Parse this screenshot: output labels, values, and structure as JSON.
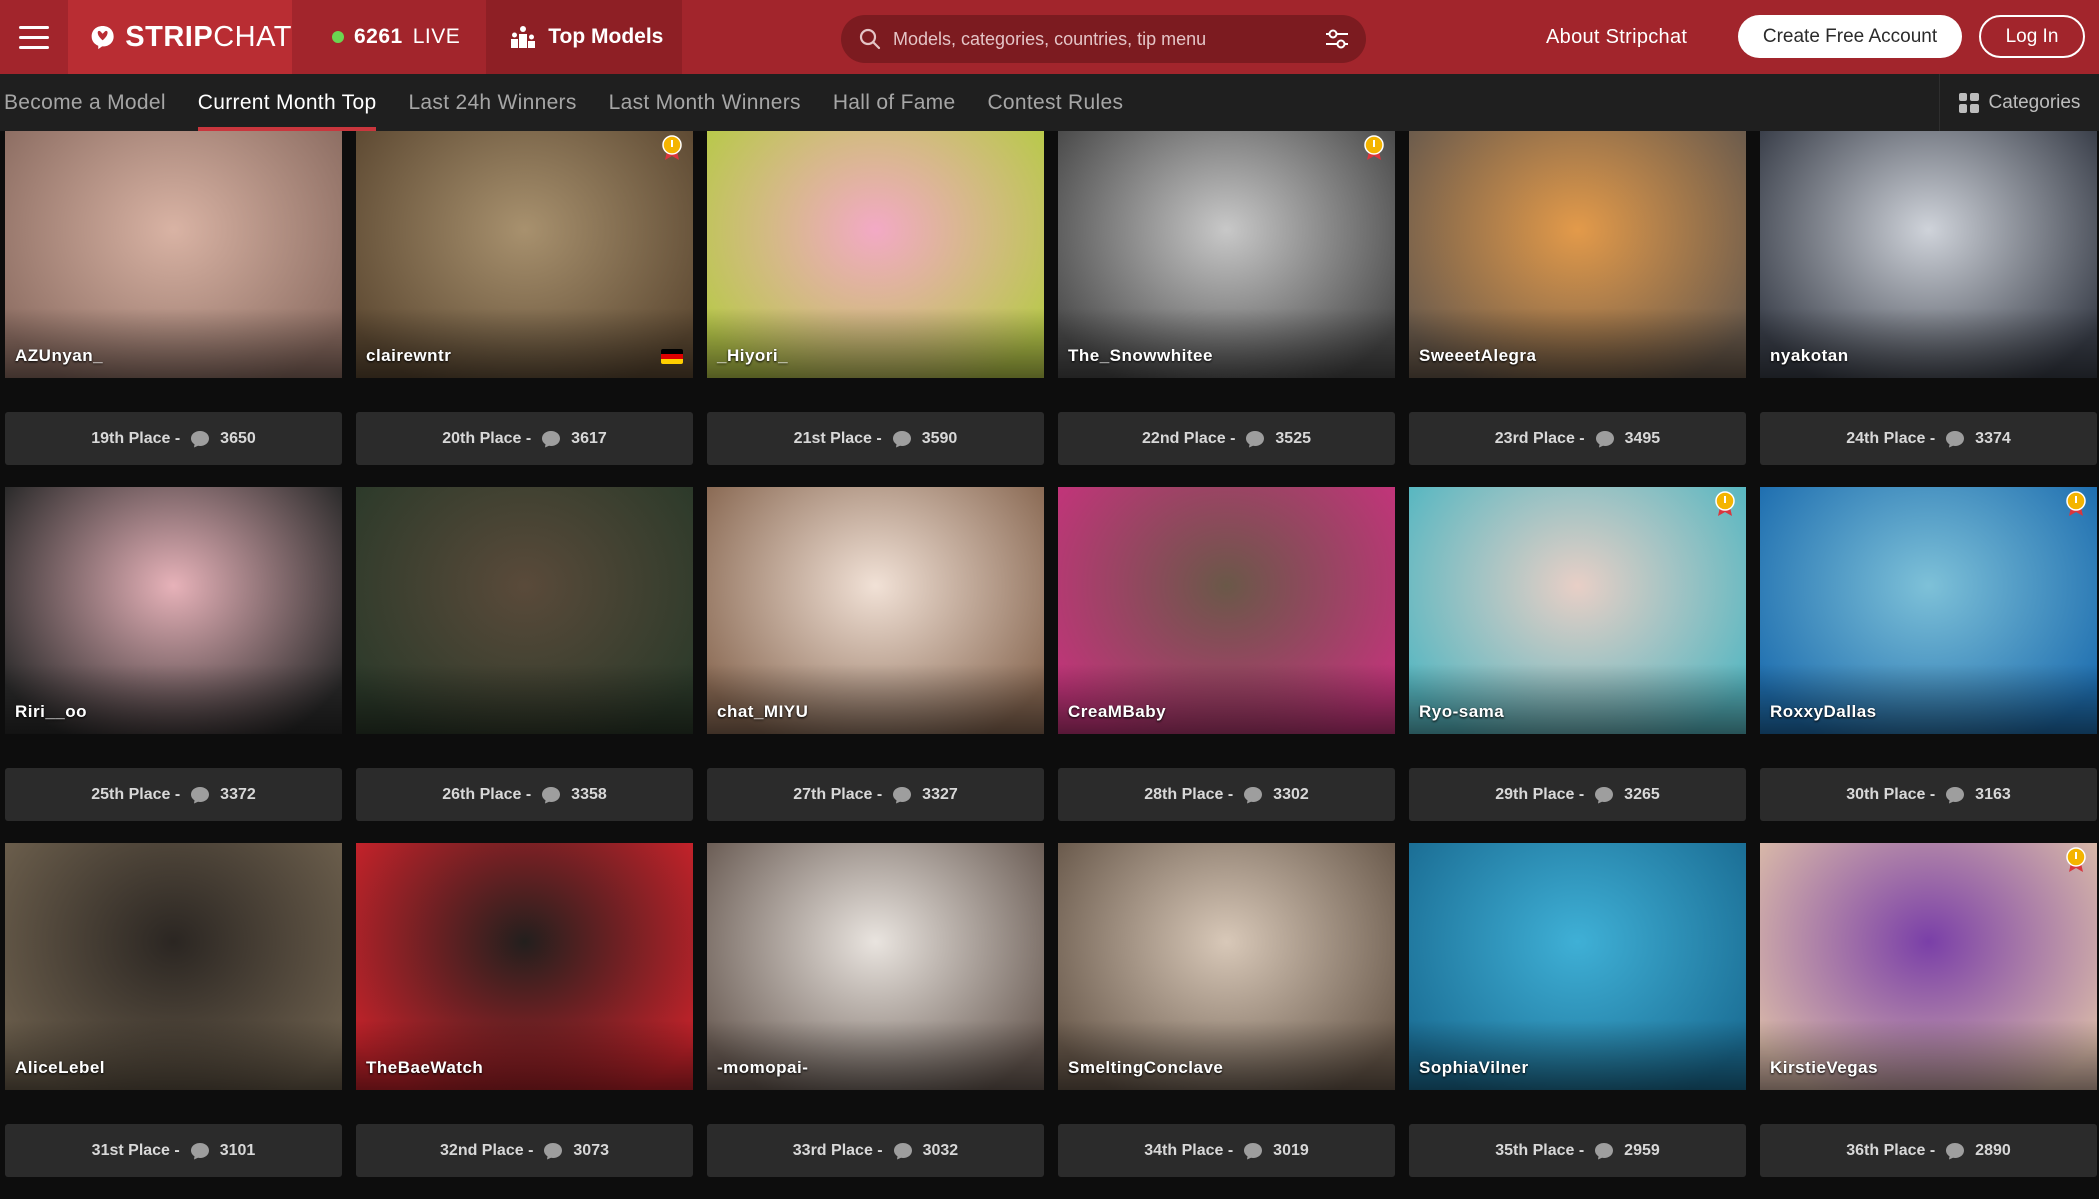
{
  "header": {
    "brand_strong": "STRIP",
    "brand_light": "CHAT",
    "live_count": "6261",
    "live_label": "LIVE",
    "top_models": "Top Models",
    "search_placeholder": "Models, categories, countries, tip menu",
    "about": "About Stripchat",
    "create_account": "Create Free Account",
    "login": "Log In",
    "colors": {
      "brand": "#a2252c",
      "accent": "#c9363d",
      "live_dot": "#6bd651"
    }
  },
  "subnav": {
    "tabs": [
      {
        "label": "Become a Model"
      },
      {
        "label": "Current Month Top"
      },
      {
        "label": "Last 24h Winners"
      },
      {
        "label": "Last Month Winners"
      },
      {
        "label": "Hall of Fame"
      },
      {
        "label": "Contest Rules"
      }
    ],
    "active_tab": "Current Month Top",
    "categories": "Categories"
  },
  "models": [
    {
      "name": "AZUnyan_",
      "place": "19th Place -",
      "score": "3650",
      "flag": "jp",
      "badge": false,
      "grad": [
        "#d9b3a4",
        "#8d6e63"
      ]
    },
    {
      "name": "clairewntr",
      "place": "20th Place -",
      "score": "3617",
      "flag": "de",
      "badge": true,
      "grad": [
        "#a8916e",
        "#5e4a33"
      ]
    },
    {
      "name": "_Hiyori_",
      "place": "21st Place -",
      "score": "3590",
      "flag": "",
      "badge": false,
      "grad": [
        "#f3a9c5",
        "#b8c94a"
      ]
    },
    {
      "name": "The_Snowwhitee",
      "place": "22nd Place -",
      "score": "3525",
      "flag": "",
      "badge": true,
      "grad": [
        "#c8c8c8",
        "#4a4a4a"
      ]
    },
    {
      "name": "SweeetAlegra",
      "place": "23rd Place -",
      "score": "3495",
      "flag": "",
      "badge": false,
      "grad": [
        "#e39a4a",
        "#6b5b4c"
      ]
    },
    {
      "name": "nyakotan",
      "place": "24th Place -",
      "score": "3374",
      "flag": "jp",
      "badge": false,
      "grad": [
        "#cfd3da",
        "#3a3f4a"
      ]
    },
    {
      "name": "Riri__oo",
      "place": "25th Place -",
      "score": "3372",
      "flag": "jp",
      "badge": false,
      "grad": [
        "#e7b2b9",
        "#2a2a2a"
      ]
    },
    {
      "name": "",
      "place": "26th Place -",
      "score": "3358",
      "flag": "",
      "badge": false,
      "grad": [
        "#5a4a3a",
        "#2c3a2a"
      ]
    },
    {
      "name": "chat_MIYU",
      "place": "27th Place -",
      "score": "3327",
      "flag": "jp",
      "badge": false,
      "grad": [
        "#f1e1d6",
        "#8a6a54"
      ]
    },
    {
      "name": "CreaMBaby",
      "place": "28th Place -",
      "score": "3302",
      "flag": "",
      "badge": false,
      "grad": [
        "#6a5848",
        "#c2347a"
      ]
    },
    {
      "name": "Ryo-sama",
      "place": "29th Place -",
      "score": "3265",
      "flag": "jp",
      "badge": true,
      "grad": [
        "#e8cfc6",
        "#57b7c1"
      ]
    },
    {
      "name": "RoxxyDallas",
      "place": "30th Place -",
      "score": "3163",
      "flag": "us",
      "badge": true,
      "grad": [
        "#7ec1d8",
        "#1f6fb0"
      ]
    },
    {
      "name": "AliceLebel",
      "place": "31st Place -",
      "score": "3101",
      "flag": "",
      "badge": false,
      "grad": [
        "#2b2622",
        "#6b5e4c"
      ]
    },
    {
      "name": "TheBaeWatch",
      "place": "32nd Place -",
      "score": "3073",
      "flag": "",
      "badge": false,
      "grad": [
        "#231f1d",
        "#c4222a"
      ]
    },
    {
      "name": "-momopai-",
      "place": "33rd Place -",
      "score": "3032",
      "flag": "",
      "badge": false,
      "grad": [
        "#e9e4df",
        "#6b5d55"
      ]
    },
    {
      "name": "SmeltingConclave",
      "place": "34th Place -",
      "score": "3019",
      "flag": "",
      "badge": false,
      "grad": [
        "#d8c8b8",
        "#6a5a4c"
      ]
    },
    {
      "name": "SophiaVilner",
      "place": "35th Place -",
      "score": "2959",
      "flag": "",
      "badge": false,
      "grad": [
        "#3fb0d6",
        "#1b6e95"
      ]
    },
    {
      "name": "KirstieVegas",
      "place": "36th Place -",
      "score": "2890",
      "flag": "",
      "badge": true,
      "grad": [
        "#7a3fa8",
        "#d8b8a8"
      ]
    }
  ]
}
